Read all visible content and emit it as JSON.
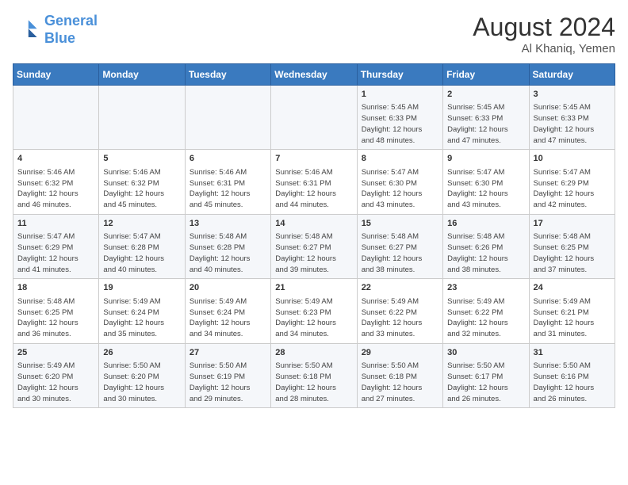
{
  "header": {
    "logo_line1": "General",
    "logo_line2": "Blue",
    "month_title": "August 2024",
    "location": "Al Khaniq, Yemen"
  },
  "weekdays": [
    "Sunday",
    "Monday",
    "Tuesday",
    "Wednesday",
    "Thursday",
    "Friday",
    "Saturday"
  ],
  "weeks": [
    [
      {
        "day": "",
        "info": ""
      },
      {
        "day": "",
        "info": ""
      },
      {
        "day": "",
        "info": ""
      },
      {
        "day": "",
        "info": ""
      },
      {
        "day": "1",
        "info": "Sunrise: 5:45 AM\nSunset: 6:33 PM\nDaylight: 12 hours\nand 48 minutes."
      },
      {
        "day": "2",
        "info": "Sunrise: 5:45 AM\nSunset: 6:33 PM\nDaylight: 12 hours\nand 47 minutes."
      },
      {
        "day": "3",
        "info": "Sunrise: 5:45 AM\nSunset: 6:33 PM\nDaylight: 12 hours\nand 47 minutes."
      }
    ],
    [
      {
        "day": "4",
        "info": "Sunrise: 5:46 AM\nSunset: 6:32 PM\nDaylight: 12 hours\nand 46 minutes."
      },
      {
        "day": "5",
        "info": "Sunrise: 5:46 AM\nSunset: 6:32 PM\nDaylight: 12 hours\nand 45 minutes."
      },
      {
        "day": "6",
        "info": "Sunrise: 5:46 AM\nSunset: 6:31 PM\nDaylight: 12 hours\nand 45 minutes."
      },
      {
        "day": "7",
        "info": "Sunrise: 5:46 AM\nSunset: 6:31 PM\nDaylight: 12 hours\nand 44 minutes."
      },
      {
        "day": "8",
        "info": "Sunrise: 5:47 AM\nSunset: 6:30 PM\nDaylight: 12 hours\nand 43 minutes."
      },
      {
        "day": "9",
        "info": "Sunrise: 5:47 AM\nSunset: 6:30 PM\nDaylight: 12 hours\nand 43 minutes."
      },
      {
        "day": "10",
        "info": "Sunrise: 5:47 AM\nSunset: 6:29 PM\nDaylight: 12 hours\nand 42 minutes."
      }
    ],
    [
      {
        "day": "11",
        "info": "Sunrise: 5:47 AM\nSunset: 6:29 PM\nDaylight: 12 hours\nand 41 minutes."
      },
      {
        "day": "12",
        "info": "Sunrise: 5:47 AM\nSunset: 6:28 PM\nDaylight: 12 hours\nand 40 minutes."
      },
      {
        "day": "13",
        "info": "Sunrise: 5:48 AM\nSunset: 6:28 PM\nDaylight: 12 hours\nand 40 minutes."
      },
      {
        "day": "14",
        "info": "Sunrise: 5:48 AM\nSunset: 6:27 PM\nDaylight: 12 hours\nand 39 minutes."
      },
      {
        "day": "15",
        "info": "Sunrise: 5:48 AM\nSunset: 6:27 PM\nDaylight: 12 hours\nand 38 minutes."
      },
      {
        "day": "16",
        "info": "Sunrise: 5:48 AM\nSunset: 6:26 PM\nDaylight: 12 hours\nand 38 minutes."
      },
      {
        "day": "17",
        "info": "Sunrise: 5:48 AM\nSunset: 6:25 PM\nDaylight: 12 hours\nand 37 minutes."
      }
    ],
    [
      {
        "day": "18",
        "info": "Sunrise: 5:48 AM\nSunset: 6:25 PM\nDaylight: 12 hours\nand 36 minutes."
      },
      {
        "day": "19",
        "info": "Sunrise: 5:49 AM\nSunset: 6:24 PM\nDaylight: 12 hours\nand 35 minutes."
      },
      {
        "day": "20",
        "info": "Sunrise: 5:49 AM\nSunset: 6:24 PM\nDaylight: 12 hours\nand 34 minutes."
      },
      {
        "day": "21",
        "info": "Sunrise: 5:49 AM\nSunset: 6:23 PM\nDaylight: 12 hours\nand 34 minutes."
      },
      {
        "day": "22",
        "info": "Sunrise: 5:49 AM\nSunset: 6:22 PM\nDaylight: 12 hours\nand 33 minutes."
      },
      {
        "day": "23",
        "info": "Sunrise: 5:49 AM\nSunset: 6:22 PM\nDaylight: 12 hours\nand 32 minutes."
      },
      {
        "day": "24",
        "info": "Sunrise: 5:49 AM\nSunset: 6:21 PM\nDaylight: 12 hours\nand 31 minutes."
      }
    ],
    [
      {
        "day": "25",
        "info": "Sunrise: 5:49 AM\nSunset: 6:20 PM\nDaylight: 12 hours\nand 30 minutes."
      },
      {
        "day": "26",
        "info": "Sunrise: 5:50 AM\nSunset: 6:20 PM\nDaylight: 12 hours\nand 30 minutes."
      },
      {
        "day": "27",
        "info": "Sunrise: 5:50 AM\nSunset: 6:19 PM\nDaylight: 12 hours\nand 29 minutes."
      },
      {
        "day": "28",
        "info": "Sunrise: 5:50 AM\nSunset: 6:18 PM\nDaylight: 12 hours\nand 28 minutes."
      },
      {
        "day": "29",
        "info": "Sunrise: 5:50 AM\nSunset: 6:18 PM\nDaylight: 12 hours\nand 27 minutes."
      },
      {
        "day": "30",
        "info": "Sunrise: 5:50 AM\nSunset: 6:17 PM\nDaylight: 12 hours\nand 26 minutes."
      },
      {
        "day": "31",
        "info": "Sunrise: 5:50 AM\nSunset: 6:16 PM\nDaylight: 12 hours\nand 26 minutes."
      }
    ]
  ]
}
